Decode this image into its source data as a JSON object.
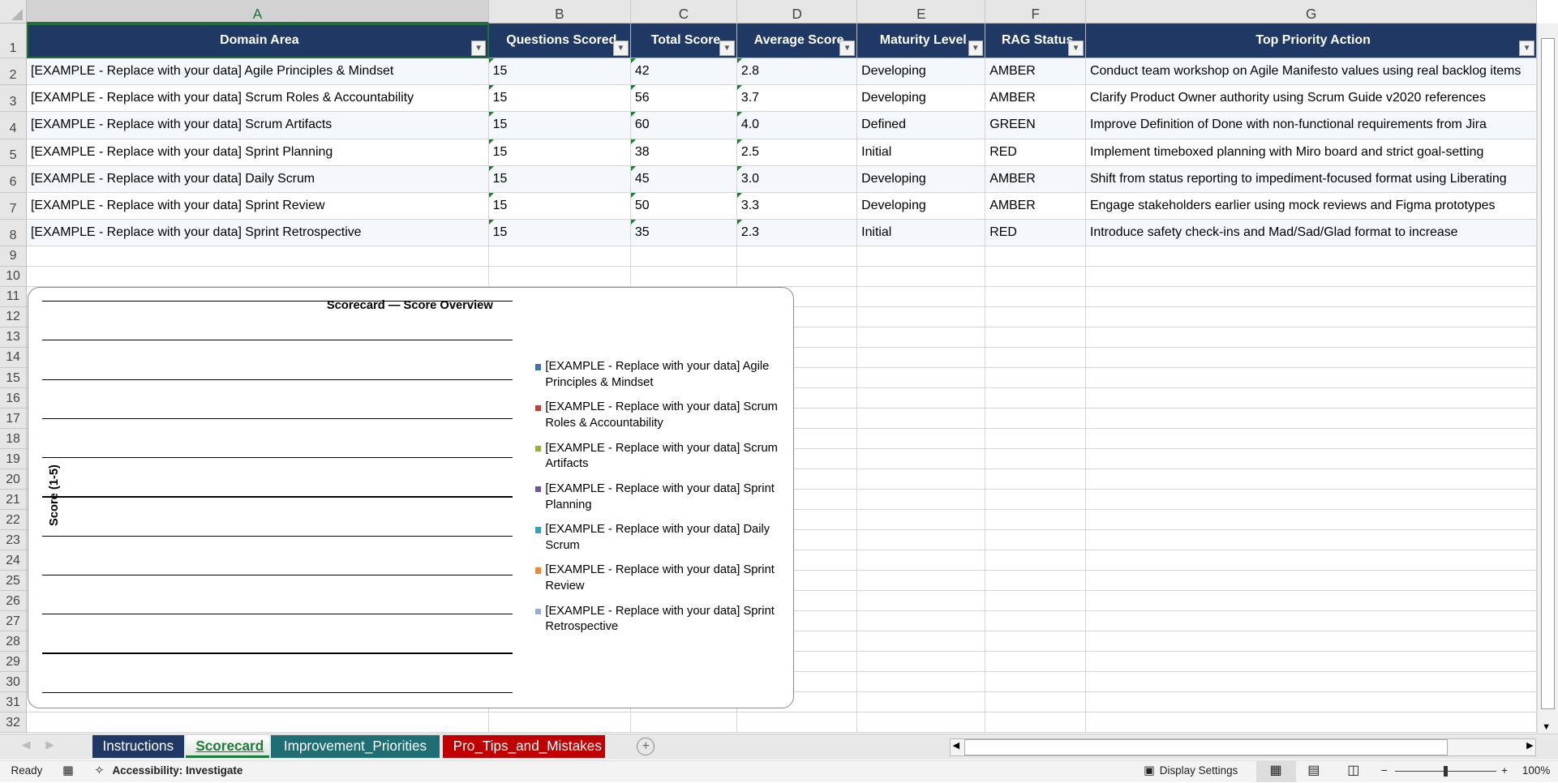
{
  "columns": [
    "A",
    "B",
    "C",
    "D",
    "E",
    "F",
    "G"
  ],
  "row_numbers": [
    "1",
    "2",
    "3",
    "4",
    "5",
    "6",
    "7",
    "8",
    "9",
    "10",
    "11",
    "12",
    "13",
    "14",
    "15",
    "16",
    "17",
    "18",
    "19",
    "20",
    "21",
    "22",
    "23",
    "24",
    "25",
    "26",
    "27",
    "28",
    "29",
    "30",
    "31",
    "32"
  ],
  "headers": [
    "Domain Area",
    "Questions Scored",
    "Total Score",
    "Average Score",
    "Maturity Level",
    "RAG Status",
    "Top Priority Action"
  ],
  "rows": [
    [
      "[EXAMPLE - Replace with your data] Agile Principles & Mindset",
      "15",
      "42",
      "2.8",
      "Developing",
      "AMBER",
      "Conduct team workshop on Agile Manifesto values using real backlog items"
    ],
    [
      "[EXAMPLE - Replace with your data] Scrum Roles & Accountability",
      "15",
      "56",
      "3.7",
      "Developing",
      "AMBER",
      "Clarify Product Owner authority using Scrum Guide v2020 references"
    ],
    [
      "[EXAMPLE - Replace with your data] Scrum Artifacts",
      "15",
      "60",
      "4.0",
      "Defined",
      "GREEN",
      "Improve Definition of Done with non-functional requirements from Jira"
    ],
    [
      "[EXAMPLE - Replace with your data] Sprint Planning",
      "15",
      "38",
      "2.5",
      "Initial",
      "RED",
      "Implement timeboxed planning with Miro board and strict goal-setting"
    ],
    [
      "[EXAMPLE - Replace with your data] Daily Scrum",
      "15",
      "45",
      "3.0",
      "Developing",
      "AMBER",
      "Shift from status reporting to impediment-focused format using Liberating"
    ],
    [
      "[EXAMPLE - Replace with your data] Sprint Review",
      "15",
      "50",
      "3.3",
      "Developing",
      "AMBER",
      "Engage stakeholders earlier using mock reviews and Figma prototypes"
    ],
    [
      "[EXAMPLE - Replace with your data] Sprint Retrospective",
      "15",
      "35",
      "2.3",
      "Initial",
      "RED",
      "Introduce safety check-ins and Mad/Sad/Glad format to increase"
    ]
  ],
  "chart_data": {
    "type": "bar",
    "title": "Scorecard — Score Overview",
    "ylabel": "Score (1-5)",
    "xlabel": "",
    "grid": true,
    "gridlines": 11,
    "legend_position": "right",
    "series": [
      {
        "name": "[EXAMPLE - Replace with your data] Agile Principles & Mindset",
        "color": "#4472a8"
      },
      {
        "name": "[EXAMPLE - Replace with your data] Scrum Roles & Accountability",
        "color": "#b84440"
      },
      {
        "name": "[EXAMPLE - Replace with your data] Scrum Artifacts",
        "color": "#8fb050"
      },
      {
        "name": "[EXAMPLE - Replace with your data] Sprint Planning",
        "color": "#6e5596"
      },
      {
        "name": "[EXAMPLE - Replace with your data] Daily Scrum",
        "color": "#3f9db4"
      },
      {
        "name": "[EXAMPLE - Replace with your data] Sprint Review",
        "color": "#ec8a3a"
      },
      {
        "name": "[EXAMPLE - Replace with your data] Sprint Retrospective",
        "color": "#97acd6"
      }
    ]
  },
  "tabs": [
    {
      "label": "Instructions",
      "color": "#203864",
      "active": false
    },
    {
      "label": "Scorecard",
      "color": "#1e7a3a",
      "active": true
    },
    {
      "label": "Improvement_Priorities",
      "color": "#1e6e74",
      "active": false
    },
    {
      "label": "Pro_Tips_and_Mistakes",
      "color": "#c00000",
      "active": false
    }
  ],
  "status": {
    "ready": "Ready",
    "accessibility": "Accessibility: Investigate",
    "display_settings": "Display Settings",
    "zoom": "100%"
  }
}
